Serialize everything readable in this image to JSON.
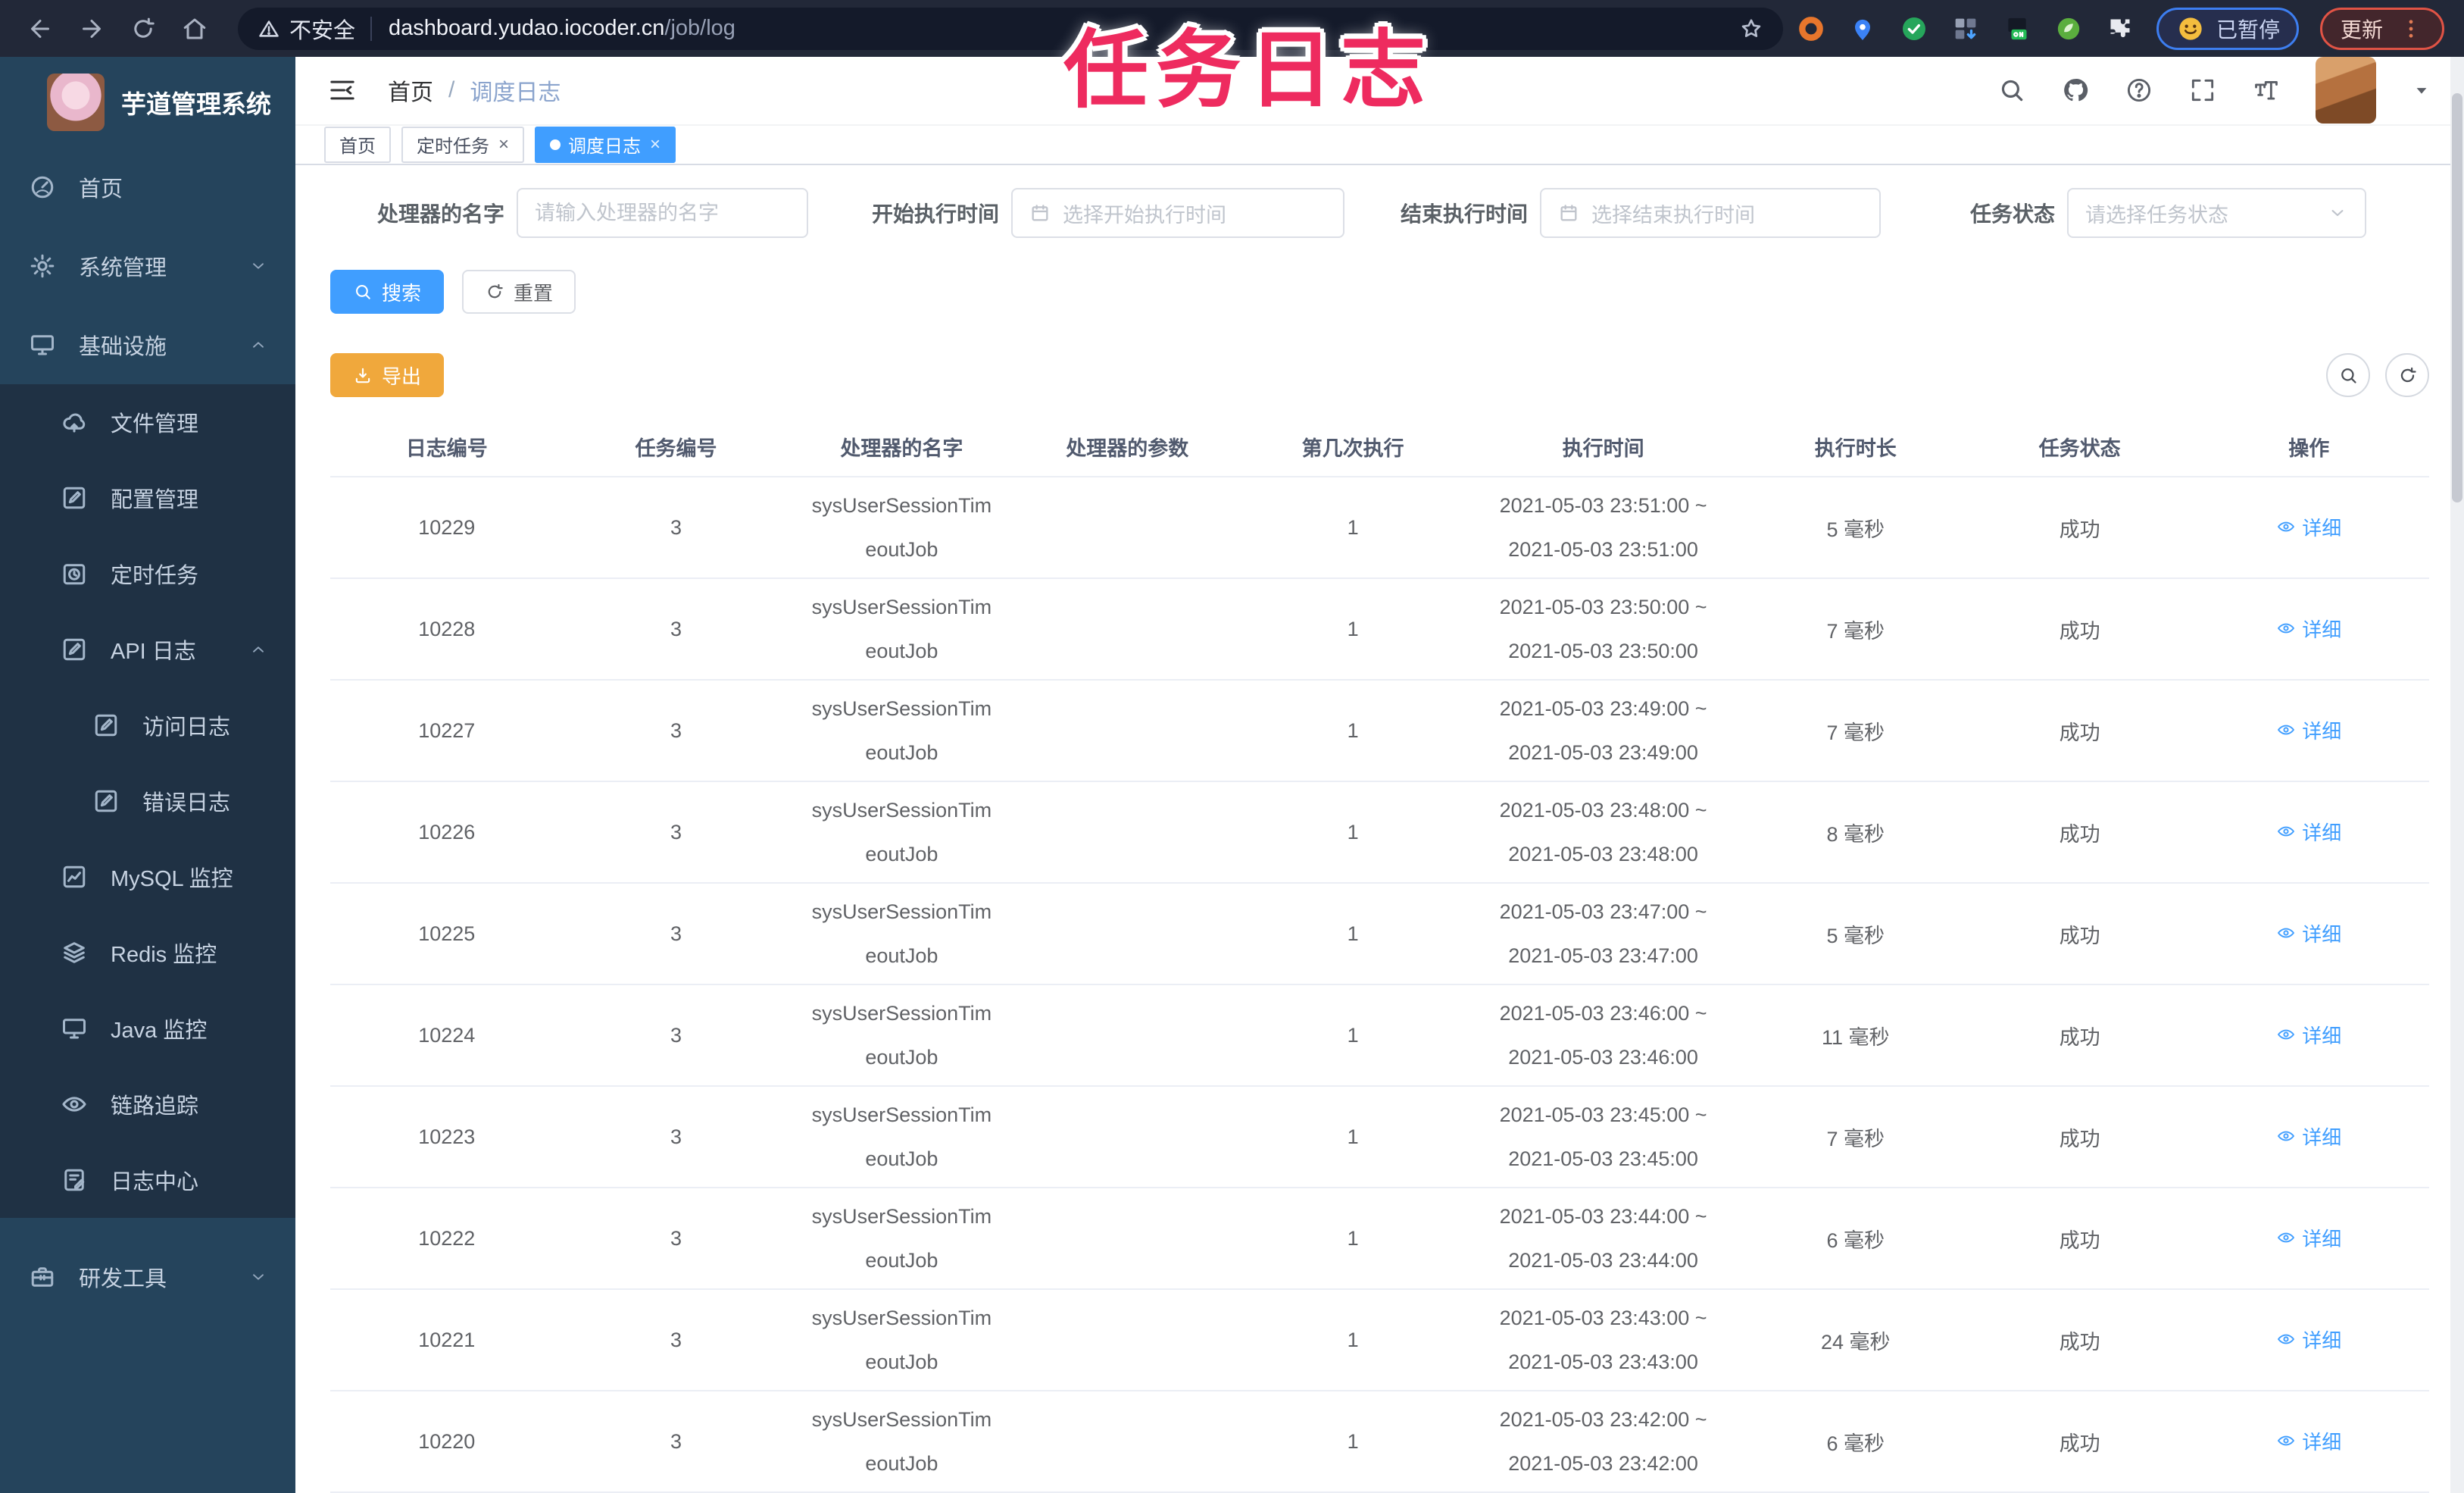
{
  "annotation": {
    "text": "任务日志",
    "color": "#ee2b5f"
  },
  "browser": {
    "security_label": "不安全",
    "url_host": "dashboard.yudao.iocoder.cn",
    "url_path": "/job/log",
    "paused_badge": "已暂停",
    "update_button": "更新"
  },
  "sidebar": {
    "title": "芋道管理系统",
    "items": [
      {
        "label": "首页",
        "icon": "dashboard",
        "level": 1
      },
      {
        "label": "系统管理",
        "icon": "gear",
        "level": 1,
        "chevron": "down"
      },
      {
        "label": "基础设施",
        "icon": "monitor",
        "level": 1,
        "chevron": "up"
      },
      {
        "label": "文件管理",
        "icon": "cloud",
        "level": 2,
        "sub": true
      },
      {
        "label": "配置管理",
        "icon": "edit",
        "level": 2,
        "sub": true
      },
      {
        "label": "定时任务",
        "icon": "timer",
        "level": 2,
        "sub": true
      },
      {
        "label": "API 日志",
        "icon": "edit",
        "level": 2,
        "sub": true,
        "chevron": "up"
      },
      {
        "label": "访问日志",
        "icon": "edit",
        "level": 3,
        "sub": true
      },
      {
        "label": "错误日志",
        "icon": "edit",
        "level": 3,
        "sub": true
      },
      {
        "label": "MySQL 监控",
        "icon": "chart",
        "level": 2,
        "sub": true
      },
      {
        "label": "Redis 监控",
        "icon": "layers",
        "level": 2,
        "sub": true
      },
      {
        "label": "Java 监控",
        "icon": "monitor",
        "level": 2,
        "sub": true
      },
      {
        "label": "链路追踪",
        "icon": "eye",
        "level": 2,
        "sub": true
      },
      {
        "label": "日志中心",
        "icon": "doc",
        "level": 2,
        "sub": true
      },
      {
        "label": "研发工具",
        "icon": "toolbox",
        "level": 1,
        "chevron": "down",
        "after_block": true
      }
    ]
  },
  "header": {
    "breadcrumb_home": "首页",
    "breadcrumb_separator": "/",
    "breadcrumb_current": "调度日志"
  },
  "tags": [
    {
      "label": "首页",
      "closable": false,
      "active": false
    },
    {
      "label": "定时任务",
      "closable": true,
      "active": false
    },
    {
      "label": "调度日志",
      "closable": true,
      "active": true
    }
  ],
  "filters": [
    {
      "label": "处理器的名字",
      "placeholder": "请输入处理器的名字",
      "type": "text"
    },
    {
      "label": "开始执行时间",
      "placeholder": "选择开始执行时间",
      "type": "date"
    },
    {
      "label": "结束执行时间",
      "placeholder": "选择结束执行时间",
      "type": "date"
    },
    {
      "label": "任务状态",
      "placeholder": "请选择任务状态",
      "type": "select"
    }
  ],
  "actions": {
    "search": "搜索",
    "reset": "重置",
    "export": "导出"
  },
  "table": {
    "columns": [
      "日志编号",
      "任务编号",
      "处理器的名字",
      "处理器的参数",
      "第几次执行",
      "执行时间",
      "执行时长",
      "任务状态",
      "操作"
    ],
    "rows": [
      {
        "log_id": "10229",
        "job_id": "3",
        "handler_line1": "sysUserSessionTim",
        "handler_line2": "eoutJob",
        "param": "",
        "count": "1",
        "time1": "2021-05-03 23:51:00 ~",
        "time2": "2021-05-03 23:51:00",
        "duration": "5 毫秒",
        "status": "成功",
        "action": "详细"
      },
      {
        "log_id": "10228",
        "job_id": "3",
        "handler_line1": "sysUserSessionTim",
        "handler_line2": "eoutJob",
        "param": "",
        "count": "1",
        "time1": "2021-05-03 23:50:00 ~",
        "time2": "2021-05-03 23:50:00",
        "duration": "7 毫秒",
        "status": "成功",
        "action": "详细"
      },
      {
        "log_id": "10227",
        "job_id": "3",
        "handler_line1": "sysUserSessionTim",
        "handler_line2": "eoutJob",
        "param": "",
        "count": "1",
        "time1": "2021-05-03 23:49:00 ~",
        "time2": "2021-05-03 23:49:00",
        "duration": "7 毫秒",
        "status": "成功",
        "action": "详细"
      },
      {
        "log_id": "10226",
        "job_id": "3",
        "handler_line1": "sysUserSessionTim",
        "handler_line2": "eoutJob",
        "param": "",
        "count": "1",
        "time1": "2021-05-03 23:48:00 ~",
        "time2": "2021-05-03 23:48:00",
        "duration": "8 毫秒",
        "status": "成功",
        "action": "详细"
      },
      {
        "log_id": "10225",
        "job_id": "3",
        "handler_line1": "sysUserSessionTim",
        "handler_line2": "eoutJob",
        "param": "",
        "count": "1",
        "time1": "2021-05-03 23:47:00 ~",
        "time2": "2021-05-03 23:47:00",
        "duration": "5 毫秒",
        "status": "成功",
        "action": "详细"
      },
      {
        "log_id": "10224",
        "job_id": "3",
        "handler_line1": "sysUserSessionTim",
        "handler_line2": "eoutJob",
        "param": "",
        "count": "1",
        "time1": "2021-05-03 23:46:00 ~",
        "time2": "2021-05-03 23:46:00",
        "duration": "11 毫秒",
        "status": "成功",
        "action": "详细"
      },
      {
        "log_id": "10223",
        "job_id": "3",
        "handler_line1": "sysUserSessionTim",
        "handler_line2": "eoutJob",
        "param": "",
        "count": "1",
        "time1": "2021-05-03 23:45:00 ~",
        "time2": "2021-05-03 23:45:00",
        "duration": "7 毫秒",
        "status": "成功",
        "action": "详细"
      },
      {
        "log_id": "10222",
        "job_id": "3",
        "handler_line1": "sysUserSessionTim",
        "handler_line2": "eoutJob",
        "param": "",
        "count": "1",
        "time1": "2021-05-03 23:44:00 ~",
        "time2": "2021-05-03 23:44:00",
        "duration": "6 毫秒",
        "status": "成功",
        "action": "详细"
      },
      {
        "log_id": "10221",
        "job_id": "3",
        "handler_line1": "sysUserSessionTim",
        "handler_line2": "eoutJob",
        "param": "",
        "count": "1",
        "time1": "2021-05-03 23:43:00 ~",
        "time2": "2021-05-03 23:43:00",
        "duration": "24 毫秒",
        "status": "成功",
        "action": "详细"
      },
      {
        "log_id": "10220",
        "job_id": "3",
        "handler_line1": "sysUserSessionTim",
        "handler_line2": "eoutJob",
        "param": "",
        "count": "1",
        "time1": "2021-05-03 23:42:00 ~",
        "time2": "2021-05-03 23:42:00",
        "duration": "6 毫秒",
        "status": "成功",
        "action": "详细"
      }
    ]
  },
  "colors": {
    "accent": "#409EFF",
    "warning": "#F0A83C",
    "sidebar": "#25445C",
    "submenu": "#1F3144",
    "annotation": "#EE2B5F"
  }
}
